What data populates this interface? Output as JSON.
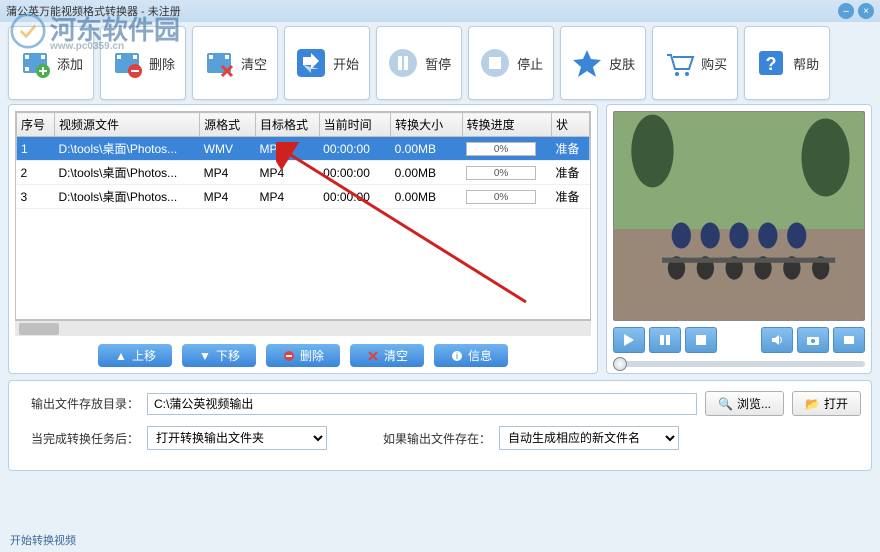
{
  "title": "蒲公英万能视频格式转换器 - 未注册",
  "watermark": {
    "text": "河东软件园",
    "sub": "www.pc0359.cn"
  },
  "toolbar": [
    {
      "id": "add",
      "label": "添加"
    },
    {
      "id": "delete",
      "label": "删除"
    },
    {
      "id": "clear",
      "label": "清空"
    },
    {
      "id": "start",
      "label": "开始"
    },
    {
      "id": "pause",
      "label": "暂停"
    },
    {
      "id": "stop",
      "label": "停止"
    },
    {
      "id": "skin",
      "label": "皮肤"
    },
    {
      "id": "buy",
      "label": "购买"
    },
    {
      "id": "help",
      "label": "帮助"
    }
  ],
  "columns": [
    "序号",
    "视频源文件",
    "源格式",
    "目标格式",
    "当前时间",
    "转换大小",
    "转换进度",
    "状"
  ],
  "rows": [
    {
      "n": "1",
      "src": "D:\\tools\\桌面\\Photos...",
      "srcfmt": "WMV",
      "tgtfmt": "MP4",
      "time": "00:00:00",
      "size": "0.00MB",
      "prog": "0%",
      "stat": "准备"
    },
    {
      "n": "2",
      "src": "D:\\tools\\桌面\\Photos...",
      "srcfmt": "MP4",
      "tgtfmt": "MP4",
      "time": "00:00:00",
      "size": "0.00MB",
      "prog": "0%",
      "stat": "准备"
    },
    {
      "n": "3",
      "src": "D:\\tools\\桌面\\Photos...",
      "srcfmt": "MP4",
      "tgtfmt": "MP4",
      "time": "00:00:00",
      "size": "0.00MB",
      "prog": "0%",
      "stat": "准备"
    }
  ],
  "listbtns": {
    "up": "上移",
    "down": "下移",
    "del": "删除",
    "clear": "清空",
    "info": "信息"
  },
  "output": {
    "dirlabel": "输出文件存放目录：",
    "dir": "C:\\蒲公英视频输出",
    "browse": "浏览...",
    "open": "打开",
    "afterlabel": "当完成转换任务后：",
    "afterval": "打开转换输出文件夹",
    "existslabel": "如果输出文件存在：",
    "existsval": "自动生成相应的新文件名"
  },
  "status": "开始转换视频"
}
